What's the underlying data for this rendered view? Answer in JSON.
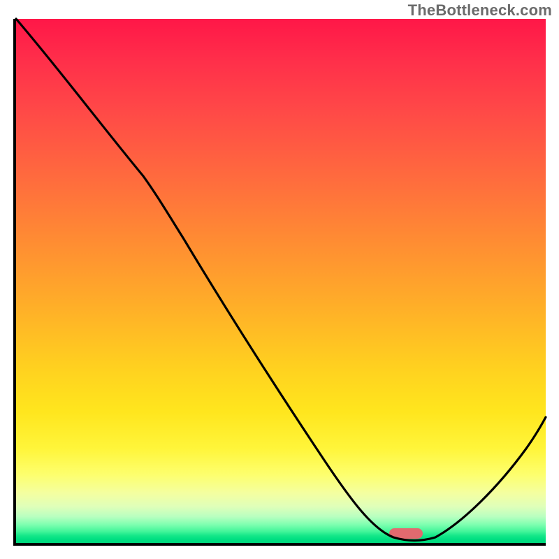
{
  "attribution": "TheBottleneck.com",
  "chart_data": {
    "type": "line",
    "title": "",
    "xlabel": "",
    "ylabel": "",
    "xlim": [
      0,
      100
    ],
    "ylim": [
      0,
      100
    ],
    "grid": false,
    "legend": false,
    "series": [
      {
        "name": "bottleneck-curve",
        "x": [
          0,
          10,
          20,
          24,
          30,
          40,
          50,
          60,
          67,
          71,
          75,
          79,
          85,
          92,
          100
        ],
        "values": [
          100,
          89,
          76,
          70,
          60,
          44,
          29,
          14,
          4,
          1,
          0,
          0,
          4,
          12,
          24
        ]
      }
    ],
    "marker": {
      "x": 74,
      "y": 0,
      "color": "#e16a6f"
    },
    "gradient_stops": [
      {
        "pos": 0.0,
        "color": "#ff1748"
      },
      {
        "pos": 0.3,
        "color": "#ff6a3e"
      },
      {
        "pos": 0.67,
        "color": "#ffd21f"
      },
      {
        "pos": 0.88,
        "color": "#fdff6e"
      },
      {
        "pos": 0.96,
        "color": "#7effb0"
      },
      {
        "pos": 1.0,
        "color": "#00d97d"
      }
    ]
  }
}
